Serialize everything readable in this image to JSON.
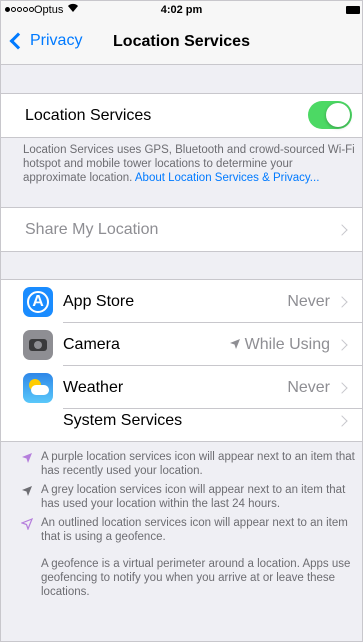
{
  "status_bar": {
    "carrier": "Optus",
    "time": "4:02 pm",
    "signal_bars_filled": 1,
    "signal_bars_total": 5
  },
  "nav": {
    "back_label": "Privacy",
    "title": "Location Services"
  },
  "location_services": {
    "label": "Location Services",
    "enabled": true,
    "description": "Location Services uses GPS, Bluetooth and crowd-sourced Wi-Fi hotspot and mobile tower locations to determine your approximate location.",
    "link": "About Location Services & Privacy..."
  },
  "share": {
    "label": "Share My Location"
  },
  "apps": [
    {
      "name": "App Store",
      "value": "Never",
      "icon": "app-store-icon"
    },
    {
      "name": "Camera",
      "value": "While Using",
      "icon": "camera-icon",
      "arrow": true
    },
    {
      "name": "Weather",
      "value": "Never",
      "icon": "weather-icon"
    }
  ],
  "system_services": {
    "label": "System Services"
  },
  "legend": [
    {
      "icon": "purple-location-arrow-icon",
      "color": "#b57edc",
      "text": "A purple location services icon will appear next to an item that has recently used your location."
    },
    {
      "icon": "grey-location-arrow-icon",
      "color": "#8e8e93",
      "text": "A grey location services icon will appear next to an item that has used your location within the last 24 hours."
    },
    {
      "icon": "outlined-location-arrow-icon",
      "color": "#b57edc",
      "text": "An outlined location services icon will appear next to an item that is using a geofence."
    }
  ],
  "geofence_note": "A geofence is a virtual perimeter around a location. Apps use geofencing to notify you when you arrive at or leave these locations.",
  "colors": {
    "accent": "#007aff",
    "toggle_on": "#4cd964",
    "background": "#efeff4"
  }
}
